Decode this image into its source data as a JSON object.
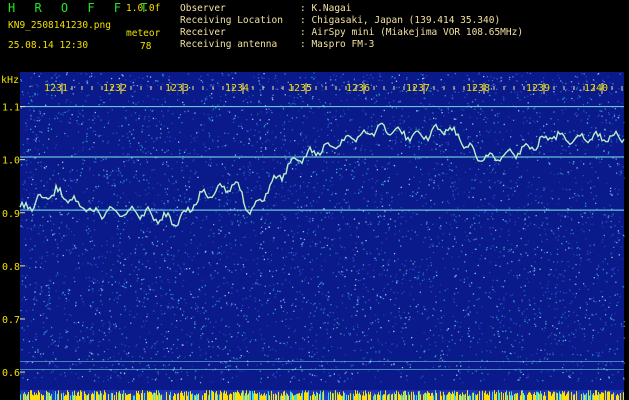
{
  "header": {
    "app_title": "H R O F F T",
    "version": "1.0.0f",
    "filename": "KN9_2508141230.png",
    "meteor_label": "meteor",
    "datetime": "25.08.14 12:30",
    "meteor_count": "78",
    "info": [
      {
        "label": "Observer",
        "value": ": K.Nagai"
      },
      {
        "label": "Receiving Location",
        "value": ": Chigasaki, Japan (139.414 35.340)"
      },
      {
        "label": "Receiver",
        "value": ": AirSpy mini (Miakejima VOR 108.65MHz)"
      },
      {
        "label": "Receiving antenna",
        "value": ": Maspro FM-3"
      }
    ]
  },
  "spectrogram": {
    "unit_label": "kHz",
    "time_ticks": [
      "1231",
      "1232",
      "1233",
      "1234",
      "1235",
      "1236",
      "1237",
      "1238",
      "1239",
      "1240"
    ],
    "freq_ticks": [
      "1.1",
      "1.0",
      "0.9",
      "0.8",
      "0.7",
      "0.6"
    ],
    "freq_range": [
      0.57,
      1.15
    ],
    "colors": {
      "background": "#0a1a8a",
      "noise_a": "#3050e0",
      "noise_b": "#20b8d0",
      "noise_c": "#a0d0ff",
      "line": "#7ae0e8",
      "signal": "#b8f0c8",
      "bottom_bar": "#ffe000"
    }
  }
}
